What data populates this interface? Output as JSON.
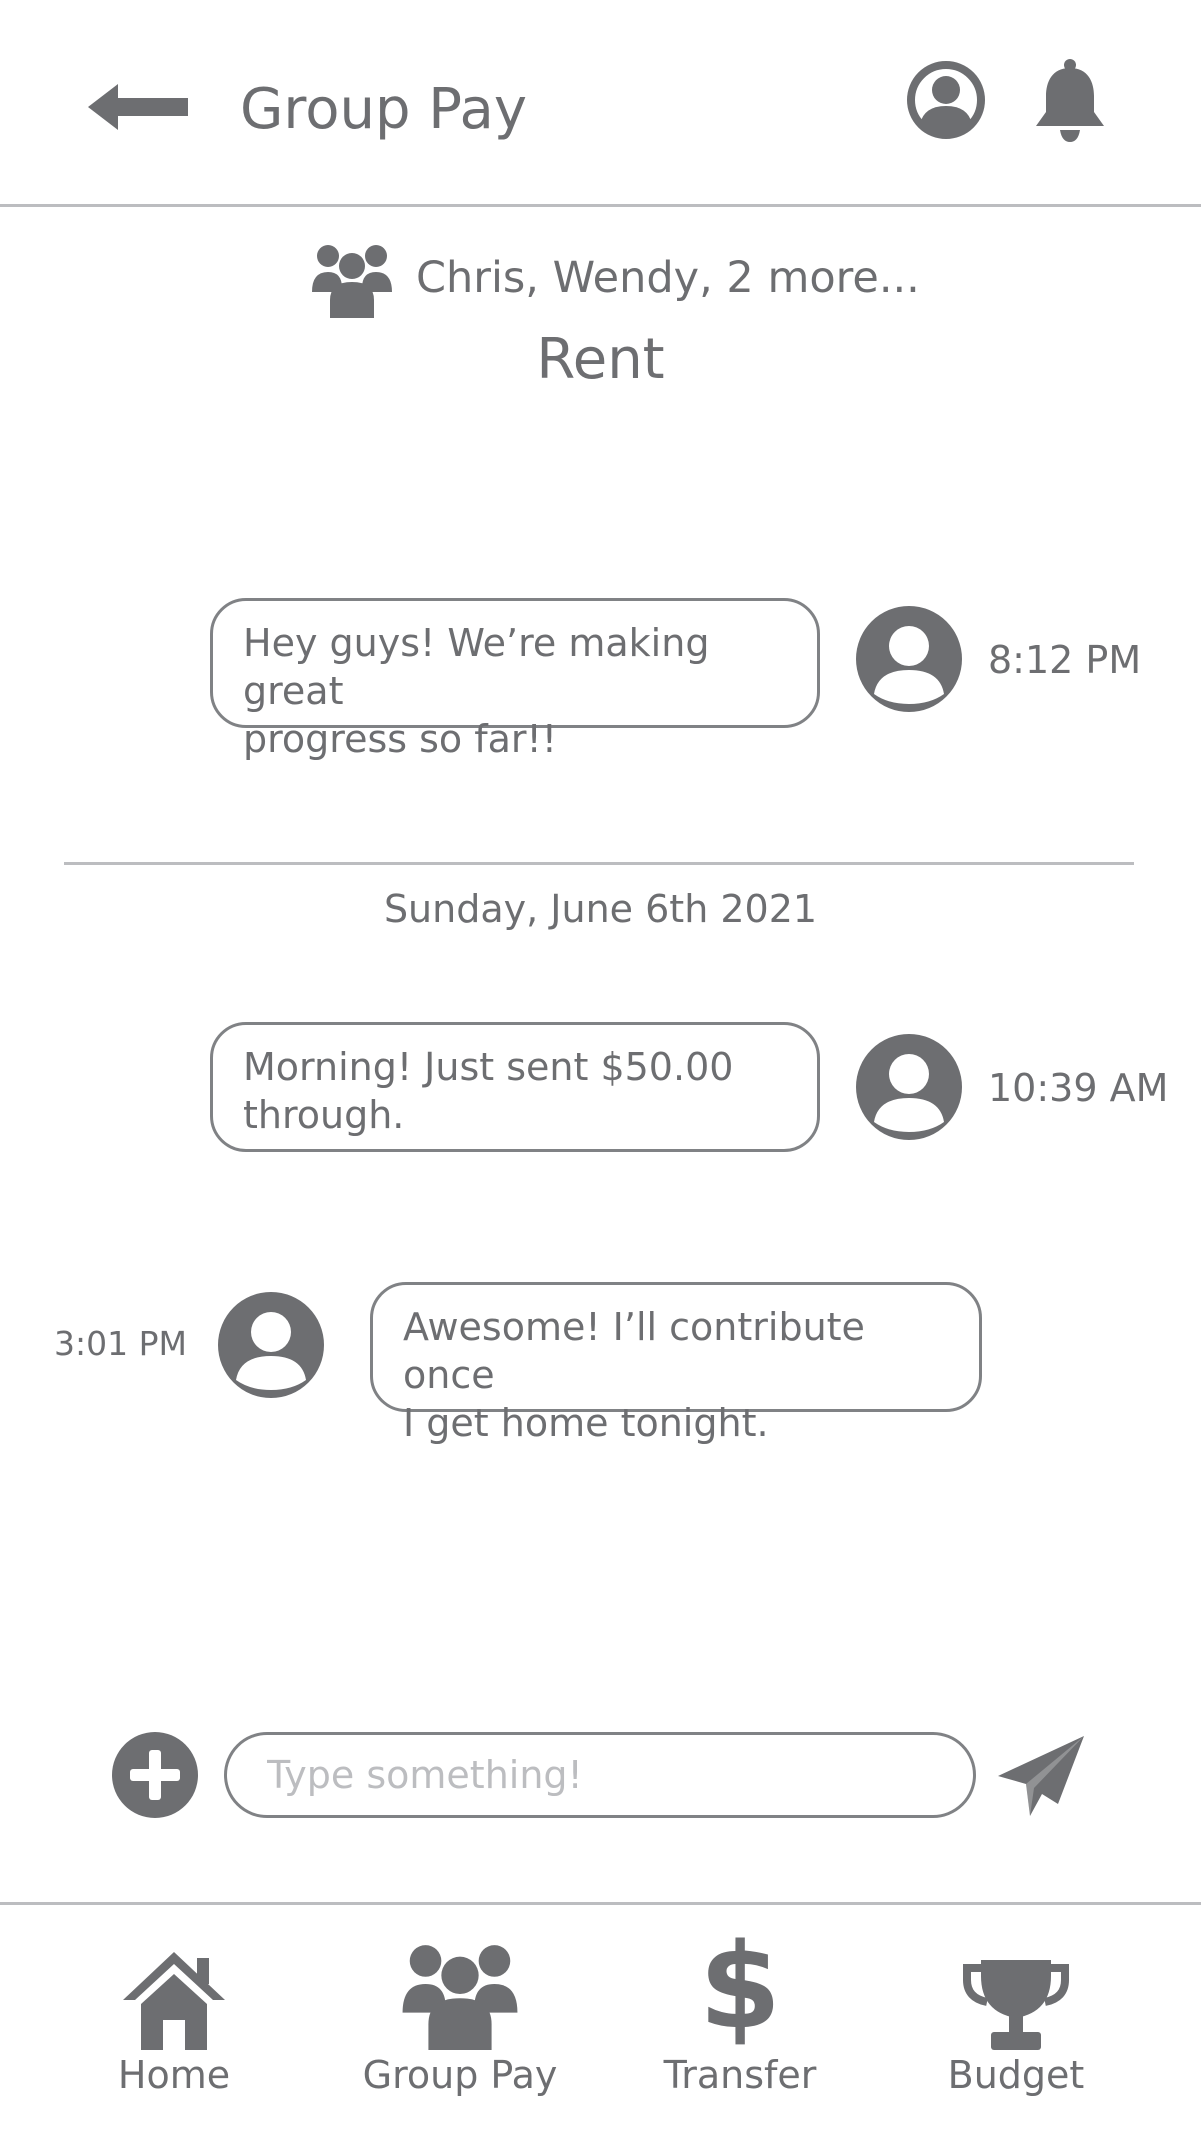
{
  "header": {
    "title": "Group Pay",
    "back_icon": "arrow-left-icon",
    "profile_icon": "user-circle-icon",
    "notifications_icon": "bell-icon"
  },
  "group": {
    "members_icon": "users-icon",
    "members": "Chris, Wendy, 2 more...",
    "name": "Rent"
  },
  "messages": [
    {
      "text": "Hey guys! We’re making great\nprogress so far!!",
      "time": "8:12 PM",
      "side": "right"
    },
    {
      "text": "Morning! Just sent $50.00\nthrough.",
      "time": "10:39 AM",
      "side": "right"
    },
    {
      "text": "Awesome! I’ll contribute once\nI get home tonight.",
      "time": "3:01 PM",
      "side": "left"
    }
  ],
  "date_divider": "Sunday, June 6th 2021",
  "composer": {
    "add_icon": "plus-circle-icon",
    "placeholder": "Type something!",
    "value": "",
    "send_icon": "paper-plane-icon"
  },
  "bottom_nav": {
    "items": [
      {
        "label": "Home",
        "icon": "home-icon"
      },
      {
        "label": "Group Pay",
        "icon": "users-icon"
      },
      {
        "label": "Transfer",
        "icon": "dollar-icon"
      },
      {
        "label": "Budget",
        "icon": "trophy-icon"
      }
    ]
  },
  "colors": {
    "icon": "#6d6e71",
    "text": "#6d6e71",
    "divider": "#bcbdc0",
    "border": "#808285",
    "placeholder": "#bcbdc0"
  }
}
